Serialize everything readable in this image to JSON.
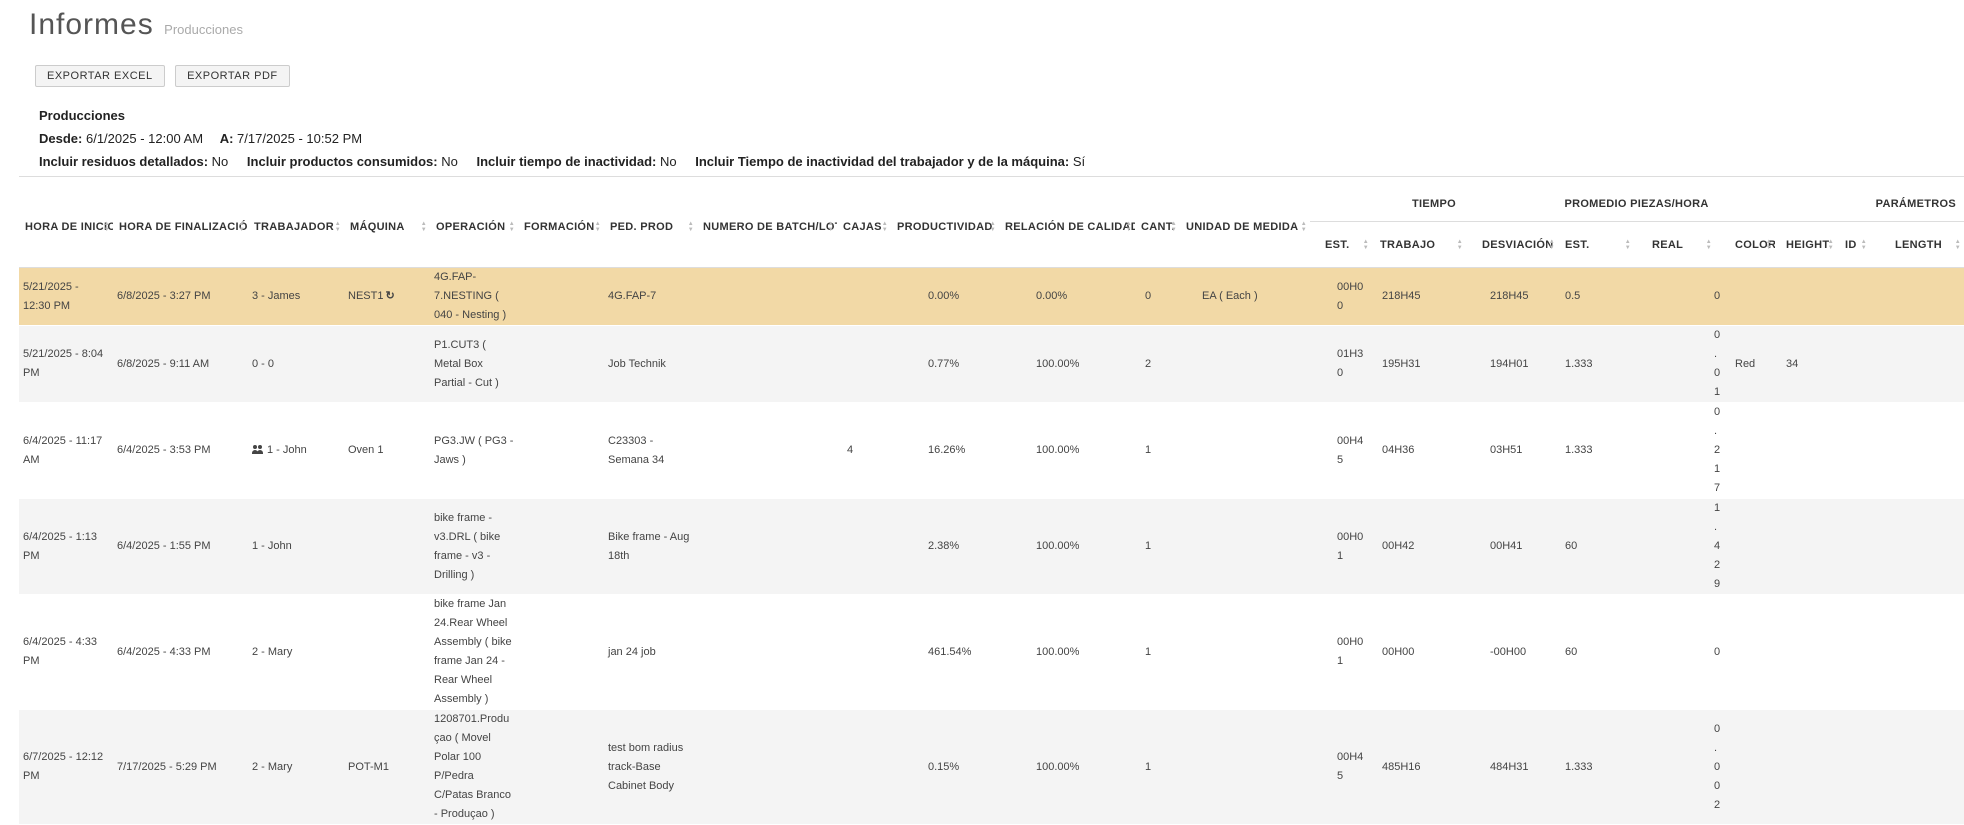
{
  "header": {
    "title": "Informes",
    "subtitle": "Producciones"
  },
  "toolbar": {
    "export_excel": "EXPORTAR EXCEL",
    "export_pdf": "EXPORTAR PDF"
  },
  "report": {
    "title": "Producciones",
    "desde_label": "Desde:",
    "desde_value": "6/1/2025 - 12:00 AM",
    "a_label": "A:",
    "a_value": "7/17/2025 - 10:52 PM",
    "f1_label": "Incluir residuos detallados:",
    "f1_value": "No",
    "f2_label": "Incluir productos consumidos:",
    "f2_value": "No",
    "f3_label": "Incluir tiempo de inactividad:",
    "f3_value": "No",
    "f4_label": "Incluir Tiempo de inactividad del trabajador y de la máquina:",
    "f4_value": "Sí"
  },
  "table": {
    "groups": {
      "tiempo": "TIEMPO",
      "promedio": "PROMEDIO PIEZAS/HORA",
      "parametros": "PARÁMETROS"
    },
    "columns": {
      "start": "HORA DE INICIO",
      "end": "HORA DE FINALIZACIÓN",
      "worker": "TRABAJADOR",
      "machine": "MÁQUINA",
      "operation": "OPERACIÓN",
      "training": "FORMACIÓN",
      "order": "PED. PROD",
      "batch": "NUMERO DE BATCH/LOTE",
      "boxes": "CAJAS",
      "productivity": "PRODUCTIVIDAD",
      "quality": "RELACIÓN DE CALIDAD",
      "qty": "CANT.",
      "uom": "UNIDAD DE MEDIDA",
      "t_est": "EST.",
      "t_work": "TRABAJO",
      "t_dev": "DESVIACIÓN",
      "p_est": "EST.",
      "p_real": "REAL",
      "color": "COLOR",
      "height": "HEIGHT",
      "id": "ID",
      "length": "LENGTH"
    },
    "rows": [
      {
        "start": "5/21/2025 - 12:30 PM",
        "end": "6/8/2025 - 3:27 PM",
        "worker": "3 - James",
        "team": false,
        "machine": "NEST1",
        "reload": true,
        "operation": "4G.FAP-7.NESTING ( 040 - Nesting )",
        "training": "",
        "order": "4G.FAP-7",
        "batch": "",
        "boxes": "",
        "productivity": "0.00%",
        "quality": "0.00%",
        "qty": "0",
        "uom": "EA ( Each )",
        "t_est": "00H00",
        "t_work": "218H45",
        "t_dev": "218H45",
        "p_est": "0.5",
        "p_real": "0",
        "color": "",
        "height": "",
        "id": "",
        "length": ""
      },
      {
        "start": "5/21/2025 - 8:04 PM",
        "end": "6/8/2025 - 9:11 AM",
        "worker": "0 - 0",
        "team": false,
        "machine": "",
        "reload": false,
        "operation": "P1.CUT3 ( Metal Box Partial - Cut )",
        "training": "",
        "order": "Job Technik",
        "batch": "",
        "boxes": "",
        "productivity": "0.77%",
        "quality": "100.00%",
        "qty": "2",
        "uom": "",
        "t_est": "01H30",
        "t_work": "195H31",
        "t_dev": "194H01",
        "p_est": "1.333",
        "p_real": "0.01",
        "color": "Red",
        "height": "34",
        "id": "",
        "length": ""
      },
      {
        "start": "6/4/2025 - 11:17 AM",
        "end": "6/4/2025 - 3:53 PM",
        "worker": "1 - John",
        "team": true,
        "machine": "Oven 1",
        "reload": false,
        "operation": "PG3.JW ( PG3 - Jaws )",
        "training": "",
        "order": "C23303 - Semana 34",
        "batch": "",
        "boxes": "4",
        "productivity": "16.26%",
        "quality": "100.00%",
        "qty": "1",
        "uom": "",
        "t_est": "00H45",
        "t_work": "04H36",
        "t_dev": "03H51",
        "p_est": "1.333",
        "p_real": "0.217",
        "color": "",
        "height": "",
        "id": "",
        "length": ""
      },
      {
        "start": "6/4/2025 - 1:13 PM",
        "end": "6/4/2025 - 1:55 PM",
        "worker": "1 - John",
        "team": false,
        "machine": "",
        "reload": false,
        "operation": "bike frame - v3.DRL ( bike frame - v3 - Drilling )",
        "training": "",
        "order": "Bike frame - Aug 18th",
        "batch": "",
        "boxes": "",
        "productivity": "2.38%",
        "quality": "100.00%",
        "qty": "1",
        "uom": "",
        "t_est": "00H01",
        "t_work": "00H42",
        "t_dev": "00H41",
        "p_est": "60",
        "p_real": "1.429",
        "color": "",
        "height": "",
        "id": "",
        "length": ""
      },
      {
        "start": "6/4/2025 - 4:33 PM",
        "end": "6/4/2025 - 4:33 PM",
        "worker": "2 - Mary",
        "team": false,
        "machine": "",
        "reload": false,
        "operation": "bike frame Jan 24.Rear Wheel Assembly ( bike frame Jan 24 - Rear Wheel Assembly )",
        "training": "",
        "order": "jan 24 job",
        "batch": "",
        "boxes": "",
        "productivity": "461.54%",
        "quality": "100.00%",
        "qty": "1",
        "uom": "",
        "t_est": "00H01",
        "t_work": "00H00",
        "t_dev": "-00H00",
        "p_est": "60",
        "p_real": "0",
        "color": "",
        "height": "",
        "id": "",
        "length": ""
      },
      {
        "start": "6/7/2025 - 12:12 PM",
        "end": "7/17/2025 - 5:29 PM",
        "worker": "2 - Mary",
        "team": false,
        "machine": "POT-M1",
        "reload": false,
        "operation": "1208701.Produçao ( Movel Polar 100 P/Pedra C/Patas Branco - Produçao )",
        "training": "",
        "order": "test bom radius track-Base Cabinet Body",
        "batch": "",
        "boxes": "",
        "productivity": "0.15%",
        "quality": "100.00%",
        "qty": "1",
        "uom": "",
        "t_est": "00H45",
        "t_work": "485H16",
        "t_dev": "484H31",
        "p_est": "1.333",
        "p_real": "0.002",
        "color": "",
        "height": "",
        "id": "",
        "length": ""
      }
    ],
    "row_colors": {
      "highlight": "#f2d9a6",
      "alt": "#f4f4f4",
      "plain": "#ffffff"
    }
  }
}
